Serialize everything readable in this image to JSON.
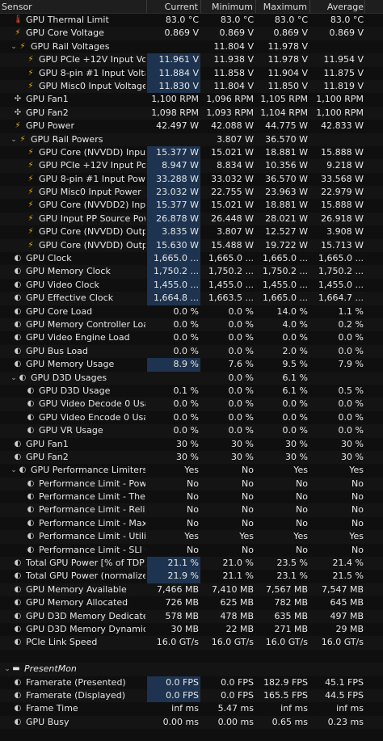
{
  "header": {
    "sensor": "Sensor",
    "current": "Current",
    "minimum": "Minimum",
    "maximum": "Maximum",
    "average": "Average"
  },
  "rows": [
    {
      "indent": 0,
      "tw": "",
      "icon": "therm",
      "label": "GPU Thermal Limit",
      "cur": "83.0 °C",
      "min": "83.0 °C",
      "max": "83.0 °C",
      "avg": "83.0 °C",
      "hl": false
    },
    {
      "indent": 0,
      "tw": "",
      "icon": "bolt",
      "label": "GPU Core Voltage",
      "cur": "0.869 V",
      "min": "0.869 V",
      "max": "0.869 V",
      "avg": "0.869 V",
      "hl": false
    },
    {
      "indent": 1,
      "tw": "v",
      "icon": "bolt",
      "label": "GPU Rail Voltages",
      "cur": "",
      "min": "11.804 V",
      "max": "11.978 V",
      "avg": "",
      "hl": false
    },
    {
      "indent": 2,
      "tw": "",
      "icon": "bolt",
      "label": "GPU PCIe +12V Input Vol...",
      "cur": "11.961 V",
      "min": "11.938 V",
      "max": "11.978 V",
      "avg": "11.954 V",
      "hl": true
    },
    {
      "indent": 2,
      "tw": "",
      "icon": "bolt",
      "label": "GPU 8-pin #1 Input Voltage",
      "cur": "11.884 V",
      "min": "11.858 V",
      "max": "11.904 V",
      "avg": "11.875 V",
      "hl": true
    },
    {
      "indent": 2,
      "tw": "",
      "icon": "bolt",
      "label": "GPU Misc0 Input Voltage",
      "cur": "11.830 V",
      "min": "11.804 V",
      "max": "11.850 V",
      "avg": "11.819 V",
      "hl": true
    },
    {
      "indent": 0,
      "tw": "",
      "icon": "fan",
      "label": "GPU Fan1",
      "cur": "1,100 RPM",
      "min": "1,096 RPM",
      "max": "1,105 RPM",
      "avg": "1,100 RPM",
      "hl": false
    },
    {
      "indent": 0,
      "tw": "",
      "icon": "fan",
      "label": "GPU Fan2",
      "cur": "1,098 RPM",
      "min": "1,093 RPM",
      "max": "1,104 RPM",
      "avg": "1,100 RPM",
      "hl": false
    },
    {
      "indent": 0,
      "tw": "",
      "icon": "bolt",
      "label": "GPU Power",
      "cur": "42.497 W",
      "min": "42.088 W",
      "max": "44.775 W",
      "avg": "42.833 W",
      "hl": false
    },
    {
      "indent": 1,
      "tw": "v",
      "icon": "bolt",
      "label": "GPU Rail Powers",
      "cur": "",
      "min": "3.807 W",
      "max": "36.570 W",
      "avg": "",
      "hl": false
    },
    {
      "indent": 2,
      "tw": "",
      "icon": "bolt",
      "label": "GPU Core (NVVDD) Input ...",
      "cur": "15.377 W",
      "min": "15.021 W",
      "max": "18.881 W",
      "avg": "15.888 W",
      "hl": true
    },
    {
      "indent": 2,
      "tw": "",
      "icon": "bolt",
      "label": "GPU PCIe +12V Input Power",
      "cur": "8.947 W",
      "min": "8.834 W",
      "max": "10.356 W",
      "avg": "9.218 W",
      "hl": true
    },
    {
      "indent": 2,
      "tw": "",
      "icon": "bolt",
      "label": "GPU 8-pin #1 Input Power",
      "cur": "33.288 W",
      "min": "33.032 W",
      "max": "36.570 W",
      "avg": "33.568 W",
      "hl": true
    },
    {
      "indent": 2,
      "tw": "",
      "icon": "bolt",
      "label": "GPU Misc0 Input Power",
      "cur": "23.032 W",
      "min": "22.755 W",
      "max": "23.963 W",
      "avg": "22.979 W",
      "hl": true
    },
    {
      "indent": 2,
      "tw": "",
      "icon": "bolt",
      "label": "GPU Core (NVVDD2) Inpu...",
      "cur": "15.377 W",
      "min": "15.021 W",
      "max": "18.881 W",
      "avg": "15.888 W",
      "hl": true
    },
    {
      "indent": 2,
      "tw": "",
      "icon": "bolt",
      "label": "GPU Input PP Source Pow...",
      "cur": "26.878 W",
      "min": "26.448 W",
      "max": "28.021 W",
      "avg": "26.918 W",
      "hl": true
    },
    {
      "indent": 2,
      "tw": "",
      "icon": "bolt",
      "label": "GPU Core (NVVDD) Outpu...",
      "cur": "3.835 W",
      "min": "3.807 W",
      "max": "12.527 W",
      "avg": "3.908 W",
      "hl": true
    },
    {
      "indent": 2,
      "tw": "",
      "icon": "bolt",
      "label": "GPU Core (NVVDD) Outpu...",
      "cur": "15.630 W",
      "min": "15.488 W",
      "max": "19.722 W",
      "avg": "15.713 W",
      "hl": true
    },
    {
      "indent": 0,
      "tw": "",
      "icon": "circ",
      "label": "GPU Clock",
      "cur": "1,665.0 ...",
      "min": "1,665.0 ...",
      "max": "1,665.0 ...",
      "avg": "1,665.0 ...",
      "hl": true
    },
    {
      "indent": 0,
      "tw": "",
      "icon": "circ",
      "label": "GPU Memory Clock",
      "cur": "1,750.2 ...",
      "min": "1,750.2 ...",
      "max": "1,750.2 ...",
      "avg": "1,750.2 ...",
      "hl": true
    },
    {
      "indent": 0,
      "tw": "",
      "icon": "circ",
      "label": "GPU Video Clock",
      "cur": "1,455.0 ...",
      "min": "1,455.0 ...",
      "max": "1,455.0 ...",
      "avg": "1,455.0 ...",
      "hl": true
    },
    {
      "indent": 0,
      "tw": "",
      "icon": "circ",
      "label": "GPU Effective Clock",
      "cur": "1,664.8 ...",
      "min": "1,663.5 ...",
      "max": "1,665.0 ...",
      "avg": "1,664.7 ...",
      "hl": true
    },
    {
      "indent": 0,
      "tw": "",
      "icon": "circ",
      "label": "GPU Core Load",
      "cur": "0.0 %",
      "min": "0.0 %",
      "max": "14.0 %",
      "avg": "1.1 %",
      "hl": false
    },
    {
      "indent": 0,
      "tw": "",
      "icon": "circ",
      "label": "GPU Memory Controller Load",
      "cur": "0.0 %",
      "min": "0.0 %",
      "max": "4.0 %",
      "avg": "0.2 %",
      "hl": false
    },
    {
      "indent": 0,
      "tw": "",
      "icon": "circ",
      "label": "GPU Video Engine Load",
      "cur": "0.0 %",
      "min": "0.0 %",
      "max": "0.0 %",
      "avg": "0.0 %",
      "hl": false
    },
    {
      "indent": 0,
      "tw": "",
      "icon": "circ",
      "label": "GPU Bus Load",
      "cur": "0.0 %",
      "min": "0.0 %",
      "max": "2.0 %",
      "avg": "0.0 %",
      "hl": false
    },
    {
      "indent": 0,
      "tw": "",
      "icon": "circ",
      "label": "GPU Memory Usage",
      "cur": "8.9 %",
      "min": "7.6 %",
      "max": "9.5 %",
      "avg": "7.9 %",
      "hl": true
    },
    {
      "indent": 1,
      "tw": "v",
      "icon": "circ",
      "label": "GPU D3D Usages",
      "cur": "",
      "min": "0.0 %",
      "max": "6.1 %",
      "avg": "",
      "hl": false
    },
    {
      "indent": 2,
      "tw": "",
      "icon": "circ",
      "label": "GPU D3D Usage",
      "cur": "0.1 %",
      "min": "0.0 %",
      "max": "6.1 %",
      "avg": "0.5 %",
      "hl": false
    },
    {
      "indent": 2,
      "tw": "",
      "icon": "circ",
      "label": "GPU Video Decode 0 Usage",
      "cur": "0.0 %",
      "min": "0.0 %",
      "max": "0.0 %",
      "avg": "0.0 %",
      "hl": false
    },
    {
      "indent": 2,
      "tw": "",
      "icon": "circ",
      "label": "GPU Video Encode 0 Usage",
      "cur": "0.0 %",
      "min": "0.0 %",
      "max": "0.0 %",
      "avg": "0.0 %",
      "hl": false
    },
    {
      "indent": 2,
      "tw": "",
      "icon": "circ",
      "label": "GPU VR Usage",
      "cur": "0.0 %",
      "min": "0.0 %",
      "max": "0.0 %",
      "avg": "0.0 %",
      "hl": false
    },
    {
      "indent": 0,
      "tw": "",
      "icon": "circ",
      "label": "GPU Fan1",
      "cur": "30 %",
      "min": "30 %",
      "max": "30 %",
      "avg": "30 %",
      "hl": false
    },
    {
      "indent": 0,
      "tw": "",
      "icon": "circ",
      "label": "GPU Fan2",
      "cur": "30 %",
      "min": "30 %",
      "max": "30 %",
      "avg": "30 %",
      "hl": false
    },
    {
      "indent": 1,
      "tw": "v",
      "icon": "circ",
      "label": "GPU Performance Limiters",
      "cur": "Yes",
      "min": "No",
      "max": "Yes",
      "avg": "Yes",
      "hl": false
    },
    {
      "indent": 2,
      "tw": "",
      "icon": "circ",
      "label": "Performance Limit - Power",
      "cur": "No",
      "min": "No",
      "max": "No",
      "avg": "No",
      "hl": false
    },
    {
      "indent": 2,
      "tw": "",
      "icon": "circ",
      "label": "Performance Limit - Thermal",
      "cur": "No",
      "min": "No",
      "max": "No",
      "avg": "No",
      "hl": false
    },
    {
      "indent": 2,
      "tw": "",
      "icon": "circ",
      "label": "Performance Limit - Reliab...",
      "cur": "No",
      "min": "No",
      "max": "No",
      "avg": "No",
      "hl": false
    },
    {
      "indent": 2,
      "tw": "",
      "icon": "circ",
      "label": "Performance Limit - Max ...",
      "cur": "No",
      "min": "No",
      "max": "No",
      "avg": "No",
      "hl": false
    },
    {
      "indent": 2,
      "tw": "",
      "icon": "circ",
      "label": "Performance Limit - Utiliza...",
      "cur": "Yes",
      "min": "Yes",
      "max": "Yes",
      "avg": "Yes",
      "hl": false
    },
    {
      "indent": 2,
      "tw": "",
      "icon": "circ",
      "label": "Performance Limit - SLI G...",
      "cur": "No",
      "min": "No",
      "max": "No",
      "avg": "No",
      "hl": false
    },
    {
      "indent": 0,
      "tw": "",
      "icon": "circ",
      "label": "Total GPU Power [% of TDP]",
      "cur": "21.1 %",
      "min": "21.0 %",
      "max": "23.5 %",
      "avg": "21.4 %",
      "hl": true
    },
    {
      "indent": 0,
      "tw": "",
      "icon": "circ",
      "label": "Total GPU Power (normalized...",
      "cur": "21.9 %",
      "min": "21.1 %",
      "max": "23.1 %",
      "avg": "21.5 %",
      "hl": true
    },
    {
      "indent": 0,
      "tw": "",
      "icon": "circ",
      "label": "GPU Memory Available",
      "cur": "7,466 MB",
      "min": "7,410 MB",
      "max": "7,567 MB",
      "avg": "7,547 MB",
      "hl": false
    },
    {
      "indent": 0,
      "tw": "",
      "icon": "circ",
      "label": "GPU Memory Allocated",
      "cur": "726 MB",
      "min": "625 MB",
      "max": "782 MB",
      "avg": "645 MB",
      "hl": false
    },
    {
      "indent": 0,
      "tw": "",
      "icon": "circ",
      "label": "GPU D3D Memory Dedicated",
      "cur": "578 MB",
      "min": "478 MB",
      "max": "635 MB",
      "avg": "497 MB",
      "hl": false
    },
    {
      "indent": 0,
      "tw": "",
      "icon": "circ",
      "label": "GPU D3D Memory Dynamic",
      "cur": "30 MB",
      "min": "22 MB",
      "max": "271 MB",
      "avg": "29 MB",
      "hl": false
    },
    {
      "indent": 0,
      "tw": "",
      "icon": "circ",
      "label": "PCIe Link Speed",
      "cur": "16.0 GT/s",
      "min": "16.0 GT/s",
      "max": "16.0 GT/s",
      "avg": "16.0 GT/s",
      "hl": false
    },
    {
      "indent": 0,
      "tw": "",
      "icon": "",
      "label": "",
      "cur": "",
      "min": "",
      "max": "",
      "avg": "",
      "hl": false
    },
    {
      "indent": 0,
      "tw": "v",
      "icon": "present",
      "label": "PresentMon",
      "cur": "",
      "min": "",
      "max": "",
      "avg": "",
      "hl": false,
      "italic": true
    },
    {
      "indent": 0,
      "tw": "",
      "icon": "circ",
      "label": "Framerate (Presented)",
      "cur": "0.0 FPS",
      "min": "0.0 FPS",
      "max": "182.9 FPS",
      "avg": "45.1 FPS",
      "hl": true
    },
    {
      "indent": 0,
      "tw": "",
      "icon": "circ",
      "label": "Framerate (Displayed)",
      "cur": "0.0 FPS",
      "min": "0.0 FPS",
      "max": "165.5 FPS",
      "avg": "44.5 FPS",
      "hl": true
    },
    {
      "indent": 0,
      "tw": "",
      "icon": "circ",
      "label": "Frame Time",
      "cur": "inf ms",
      "min": "5.47 ms",
      "max": "inf ms",
      "avg": "inf ms",
      "hl": false
    },
    {
      "indent": 0,
      "tw": "",
      "icon": "circ",
      "label": "GPU Busy",
      "cur": "0.00 ms",
      "min": "0.00 ms",
      "max": "0.65 ms",
      "avg": "0.23 ms",
      "hl": false
    }
  ]
}
